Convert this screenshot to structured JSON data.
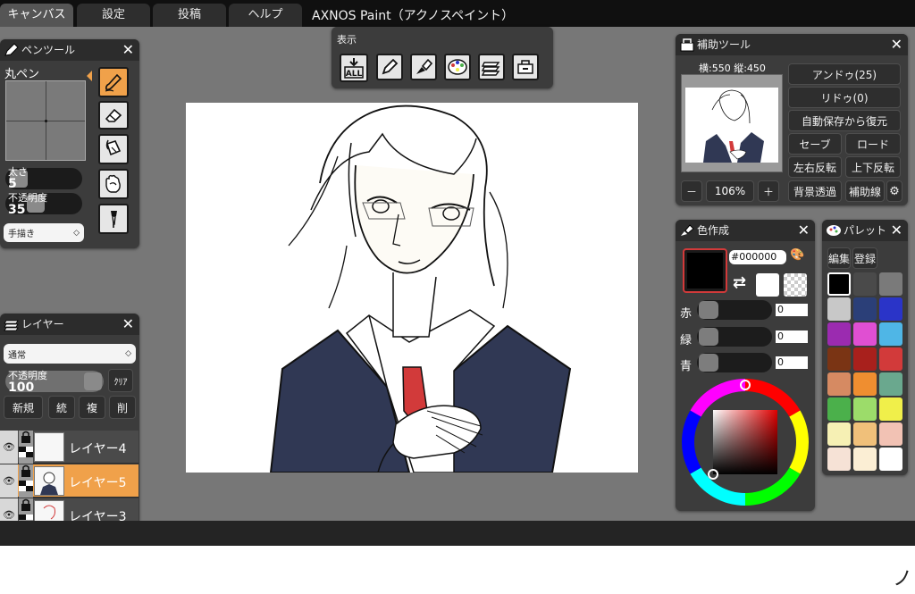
{
  "menu": {
    "tabs": [
      "キャンバス",
      "設定",
      "投稿",
      "ヘルプ"
    ],
    "active_tab": "キャンバス",
    "app_title": "AXNOS Paint（アクノスペイント）"
  },
  "pen_tool": {
    "title": "ペンツール",
    "brush_name": "丸ペン",
    "size_label": "太さ",
    "size_value": "5",
    "size_fraction": 0.05,
    "opacity_label": "不透明度",
    "opacity_value": "35",
    "opacity_fraction": 0.35,
    "mode_value": "手描き",
    "tools": [
      "pen-icon",
      "eraser-icon",
      "bucket-icon",
      "hand-icon",
      "eyedropper-icon"
    ],
    "active_tool": "pen-icon"
  },
  "view_panel": {
    "title": "表示",
    "tools": [
      "select-all-icon",
      "pen-tool-toggle-icon",
      "color-tool-toggle-icon",
      "palette-toggle-icon",
      "layer-toggle-icon",
      "assist-tool-toggle-icon"
    ],
    "select_all_text": "ALL"
  },
  "layers": {
    "title": "レイヤー",
    "blend_mode": "通常",
    "opacity_label": "不透明度",
    "opacity_value": "100",
    "opacity_fraction": 1.0,
    "clear_label": "ｸﾘｱ",
    "buttons": [
      "新規",
      "統",
      "複",
      "削"
    ],
    "items": [
      {
        "name": "レイヤー4",
        "selected": false
      },
      {
        "name": "レイヤー5",
        "selected": true
      },
      {
        "name": "レイヤー3",
        "selected": false
      }
    ]
  },
  "assist_tool": {
    "title": "補助ツール",
    "canvas_size": "横:550 縦:450",
    "undo_label": "アンドゥ(25)",
    "redo_label": "リドゥ(0)",
    "restore_label": "自動保存から復元",
    "save_label": "セーブ",
    "load_label": "ロード",
    "flip_h_label": "左右反転",
    "flip_v_label": "上下反転",
    "bg_transparent_label": "背景透過",
    "guide_label": "補助線",
    "zoom_minus": "－",
    "zoom_value": "106%",
    "zoom_plus": "＋"
  },
  "color_make": {
    "title": "色作成",
    "hex": "#000000",
    "current_color": "#000000",
    "secondary_color": "#ffffff",
    "red_label": "赤",
    "green_label": "緑",
    "blue_label": "青",
    "red_value": "0",
    "green_value": "0",
    "blue_value": "0"
  },
  "palette": {
    "title": "パレット",
    "edit_label": "編集",
    "register_label": "登録",
    "colors": [
      "#000000",
      "#4a4a4a",
      "#7a7a7a",
      "#c8c8c8",
      "#2b3f78",
      "#2a34c8",
      "#9b2bb0",
      "#e04fd2",
      "#4fb6e6",
      "#7a3414",
      "#a8201c",
      "#d23a3a",
      "#d68a62",
      "#ef8e30",
      "#6aa88e",
      "#4bb04b",
      "#9cdc6a",
      "#f0ef4a",
      "#f6f0b4",
      "#f0c07a",
      "#f2c2b4",
      "#f6e2d6",
      "#fbeed4",
      "#ffffff"
    ]
  },
  "theme": {
    "accent": "#f0a14a",
    "workspace": "#777777",
    "panel": "#3c3c3c"
  }
}
